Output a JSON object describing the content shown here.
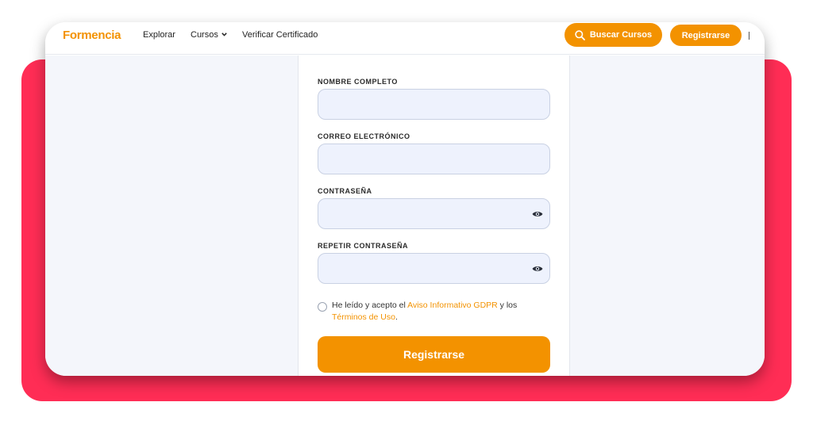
{
  "brand": {
    "name": "Formencia",
    "color": "#f39200"
  },
  "nav": {
    "links": [
      "Explorar",
      "Cursos",
      "Verificar Certificado"
    ],
    "search_button": "Buscar Cursos",
    "register_button": "Registrarse"
  },
  "icons": {
    "search": "search-icon",
    "chevron": "chevron-down-icon",
    "eye": "eye-icon"
  },
  "form": {
    "fields": [
      {
        "label": "NOMBRE COMPLETO",
        "value": ""
      },
      {
        "label": "CORREO ELECTRÓNICO",
        "value": ""
      },
      {
        "label": "CONTRASEÑA",
        "value": ""
      },
      {
        "label": "REPETIR CONTRASEÑA",
        "value": ""
      }
    ],
    "terms": {
      "prefix": "He leído y acepto el ",
      "link1": "Aviso Informativo GDPR",
      "middle": " y los ",
      "link2": "Términos de Uso",
      "suffix": "."
    },
    "submit": "Registrarse"
  },
  "colors": {
    "accent": "#f39200",
    "backdrop": "#ff2d55",
    "input_bg": "#eef2fd"
  }
}
